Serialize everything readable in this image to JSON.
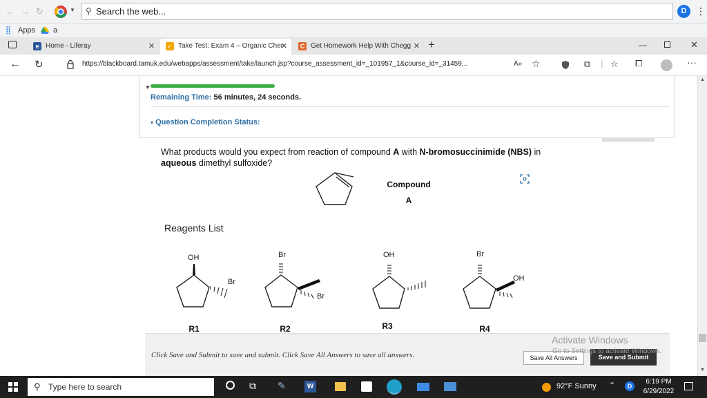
{
  "browser": {
    "search_placeholder": "Search the web...",
    "apps_label": "Apps",
    "bookmark_label": "a",
    "tabs": [
      {
        "label": "Home - Liferay",
        "favicon": "e"
      },
      {
        "label": "Take Test: Exam 4 – Organic Cher",
        "favicon": "✓"
      },
      {
        "label": "Get Homework Help With Chegg",
        "favicon": "C"
      }
    ],
    "new_tab": "+",
    "url": "https://blackboard.tamuk.edu/webapps/assessment/take/launch.jsp?course_assessment_id=_101957_1&course_id=_31459...",
    "reader_icon": "A»",
    "extension_letter": "D"
  },
  "test": {
    "remaining_label": "Remaining Time:",
    "remaining_minutes": "56",
    "minutes_word": "minutes,",
    "remaining_seconds": "24",
    "seconds_word": "seconds.",
    "completion_status": "Question Completion Status:"
  },
  "question": {
    "part1": "What products would you expect from reaction of compound ",
    "compound": "A",
    "part2": " with ",
    "reagent": "N-bromosuccinimide (NBS)",
    "part3": " in ",
    "solvent": "aqueous",
    "part4": " dimethyl sulfoxide?",
    "compound_label": "Compound",
    "compound_letter": "A"
  },
  "reagents": {
    "title": "Reagents List",
    "items": [
      {
        "id": "R1",
        "top": "OH",
        "side": "Br"
      },
      {
        "id": "R2",
        "top": "Br",
        "side": "Br"
      },
      {
        "id": "R3",
        "top": "OH"
      },
      {
        "id": "R4",
        "top": "Br",
        "side": "OH"
      }
    ]
  },
  "footer": {
    "instructions": "Click Save and Submit to save and submit. Click Save All Answers to save all answers.",
    "save_all": "Save All Answers",
    "save_submit": "Save and Submit"
  },
  "watermark": {
    "title": "Activate Windows",
    "subtitle": "Go to Settings to activate Windows."
  },
  "taskbar": {
    "search_placeholder": "Type here to search",
    "weather": "92°F Sunny",
    "time": "6:19 PM",
    "date": "6/29/2022"
  },
  "colors": {
    "accent": "#2b6ca3",
    "progress": "#3cb043",
    "taskbar": "#1f1f1f"
  }
}
